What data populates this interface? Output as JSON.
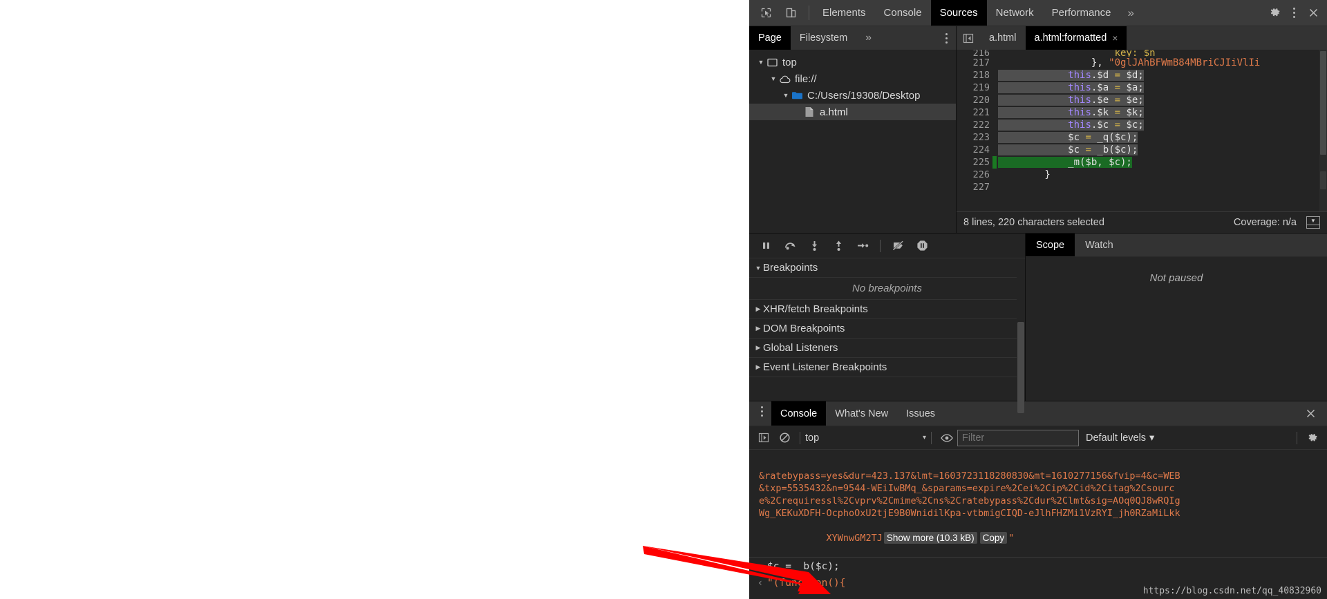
{
  "main_tabs": {
    "inspect_icon": "inspect-element-icon",
    "device_icon": "device-toolbar-icon",
    "items": [
      {
        "label": "Elements",
        "active": false
      },
      {
        "label": "Console",
        "active": false
      },
      {
        "label": "Sources",
        "active": true
      },
      {
        "label": "Network",
        "active": false
      },
      {
        "label": "Performance",
        "active": false
      }
    ],
    "more_label": "»",
    "settings_icon": "gear-icon",
    "menu_icon": "more-vertical-icon",
    "close_icon": "close-icon"
  },
  "navigator": {
    "tabs": [
      {
        "label": "Page",
        "active": true
      },
      {
        "label": "Filesystem",
        "active": false
      }
    ],
    "more_label": "»",
    "menu_icon": "more-vertical-icon",
    "tree": [
      {
        "label": "top",
        "icon": "frame-icon",
        "indent": 0,
        "expanded": true,
        "selected": false
      },
      {
        "label": "file://",
        "icon": "cloud-icon",
        "indent": 1,
        "expanded": true,
        "selected": false
      },
      {
        "label": "C:/Users/19308/Desktop",
        "icon": "folder-icon",
        "indent": 2,
        "expanded": true,
        "selected": false
      },
      {
        "label": "a.html",
        "icon": "file-icon",
        "indent": 3,
        "expanded": null,
        "selected": true
      }
    ]
  },
  "editor": {
    "back_icon": "navigator-toggle-icon",
    "tabs": [
      {
        "label": "a.html",
        "active": false,
        "closable": false
      },
      {
        "label": "a.html:formatted",
        "active": true,
        "closable": true
      }
    ],
    "close_glyph": "×",
    "lines": [
      {
        "num": "216",
        "clipped": true,
        "segments": [
          {
            "t": "                    key: $n",
            "c": "tok-op"
          }
        ],
        "selected": false,
        "exec": false
      },
      {
        "num": "217",
        "segments": [
          {
            "t": "                ",
            "c": "tok-pl"
          },
          {
            "t": "}, ",
            "c": "tok-pl"
          },
          {
            "t": "\"0glJAhBFWmB84MBriCJIiVlIi",
            "c": "tok-str"
          }
        ],
        "selected": false,
        "exec": false
      },
      {
        "num": "218",
        "segments": [
          {
            "t": "            ",
            "c": "tok-pl"
          },
          {
            "t": "this",
            "c": "tok-kw"
          },
          {
            "t": ".$d ",
            "c": "tok-pl"
          },
          {
            "t": "= ",
            "c": "tok-op"
          },
          {
            "t": "$d;",
            "c": "tok-pl"
          }
        ],
        "selected": true,
        "exec": false
      },
      {
        "num": "219",
        "segments": [
          {
            "t": "            ",
            "c": "tok-pl"
          },
          {
            "t": "this",
            "c": "tok-kw"
          },
          {
            "t": ".$a ",
            "c": "tok-pl"
          },
          {
            "t": "= ",
            "c": "tok-op"
          },
          {
            "t": "$a;",
            "c": "tok-pl"
          }
        ],
        "selected": true,
        "exec": false
      },
      {
        "num": "220",
        "segments": [
          {
            "t": "            ",
            "c": "tok-pl"
          },
          {
            "t": "this",
            "c": "tok-kw"
          },
          {
            "t": ".$e ",
            "c": "tok-pl"
          },
          {
            "t": "= ",
            "c": "tok-op"
          },
          {
            "t": "$e;",
            "c": "tok-pl"
          }
        ],
        "selected": true,
        "exec": false
      },
      {
        "num": "221",
        "segments": [
          {
            "t": "            ",
            "c": "tok-pl"
          },
          {
            "t": "this",
            "c": "tok-kw"
          },
          {
            "t": ".$k ",
            "c": "tok-pl"
          },
          {
            "t": "= ",
            "c": "tok-op"
          },
          {
            "t": "$k;",
            "c": "tok-pl"
          }
        ],
        "selected": true,
        "exec": false
      },
      {
        "num": "222",
        "segments": [
          {
            "t": "            ",
            "c": "tok-pl"
          },
          {
            "t": "this",
            "c": "tok-kw"
          },
          {
            "t": ".$c ",
            "c": "tok-pl"
          },
          {
            "t": "= ",
            "c": "tok-op"
          },
          {
            "t": "$c;",
            "c": "tok-pl"
          }
        ],
        "selected": true,
        "exec": false
      },
      {
        "num": "223",
        "segments": [
          {
            "t": "            $c ",
            "c": "tok-pl"
          },
          {
            "t": "= ",
            "c": "tok-op"
          },
          {
            "t": "_q($c);",
            "c": "tok-pl"
          }
        ],
        "selected": true,
        "exec": false
      },
      {
        "num": "224",
        "segments": [
          {
            "t": "            $c ",
            "c": "tok-pl"
          },
          {
            "t": "= ",
            "c": "tok-op"
          },
          {
            "t": "_b($c);",
            "c": "tok-pl"
          }
        ],
        "selected": true,
        "exec": false
      },
      {
        "num": "225",
        "segments": [
          {
            "t": "            _m($b, $c);",
            "c": "tok-pl"
          }
        ],
        "selected": true,
        "exec": true
      },
      {
        "num": "226",
        "segments": [
          {
            "t": "        }",
            "c": "tok-pl"
          }
        ],
        "selected": false,
        "exec": false
      },
      {
        "num": "227",
        "segments": [
          {
            "t": "",
            "c": "tok-pl"
          }
        ],
        "selected": false,
        "exec": false
      }
    ],
    "status_left": "8 lines, 220 characters selected",
    "status_right": "Coverage: n/a",
    "status_icon": "drawer-toggle-icon"
  },
  "debugger": {
    "toolbar_icons": [
      {
        "name": "pause-icon"
      },
      {
        "name": "step-over-icon"
      },
      {
        "name": "step-into-icon"
      },
      {
        "name": "step-out-icon"
      },
      {
        "name": "step-icon"
      },
      {
        "name": "deactivate-breakpoints-icon"
      },
      {
        "name": "pause-on-exceptions-icon"
      }
    ],
    "sections": [
      {
        "label": "Breakpoints",
        "expanded": true,
        "empty_text": "No breakpoints"
      },
      {
        "label": "XHR/fetch Breakpoints",
        "expanded": false
      },
      {
        "label": "DOM Breakpoints",
        "expanded": false
      },
      {
        "label": "Global Listeners",
        "expanded": false
      },
      {
        "label": "Event Listener Breakpoints",
        "expanded": false
      }
    ],
    "scope_tabs": [
      {
        "label": "Scope",
        "active": true
      },
      {
        "label": "Watch",
        "active": false
      }
    ],
    "not_paused_text": "Not paused"
  },
  "drawer": {
    "menu_icon": "more-vertical-icon",
    "tabs": [
      {
        "label": "Console",
        "active": true
      },
      {
        "label": "What's New",
        "active": false
      },
      {
        "label": "Issues",
        "active": false
      }
    ],
    "close_icon": "close-icon",
    "toolbar": {
      "sidebar_icon": "console-sidebar-icon",
      "clear_icon": "clear-console-icon",
      "context_value": "top",
      "context_arrow": "▾",
      "eye_icon": "live-expression-icon",
      "filter_placeholder": "Filter",
      "filter_value": "",
      "levels_label": "Default levels",
      "levels_arrow": "▾",
      "settings_icon": "gear-icon"
    },
    "messages": [
      {
        "text": "&ratebypass=yes&dur=423.137&lmt=1603723118280830&mt=1610277156&fvip=4&c=WEB"
      },
      {
        "text": "&txp=5535432&n=9544-WEiIwBMq_&sparams=expire%2Cei%2Cip%2Cid%2Citag%2Csourc"
      },
      {
        "text": "e%2Crequiressl%2Cvprv%2Cmime%2Cns%2Cratebypass%2Cdur%2Clmt&sig=AOq0QJ8wRQIg"
      },
      {
        "text": "Wg_KEKuXDFH-OcphoOxU2tjE9B0WnidilKpa-vtbmigCIQD-eJlhFHZMi1VzRYI_jh0RZaMiLkk"
      }
    ],
    "tail_text": "XYWnwGM2TJ",
    "show_more_label": "Show more (10.3 kB)",
    "copy_label": "Copy",
    "tail_quote": "\"",
    "prompt": {
      "chevron": "›",
      "input_value": "$c = _b($c);",
      "return_chevron": "‹",
      "return_value": "\"(function(){"
    },
    "watermark": "https://blog.csdn.net/qq_40832960"
  },
  "annotation": {
    "arrow_name": "red-pointer-arrow",
    "color": "#ff0000"
  },
  "colors": {
    "panel_bg": "#242424",
    "tabbar_bg": "#333333",
    "active_tab_bg": "#000000",
    "selection_bg": "#4f4f4f",
    "exec_line_bg": "#1a6b24",
    "string_token": "#e07a4a",
    "keyword_token": "#a387ff",
    "operator_token": "#d4b44a"
  }
}
